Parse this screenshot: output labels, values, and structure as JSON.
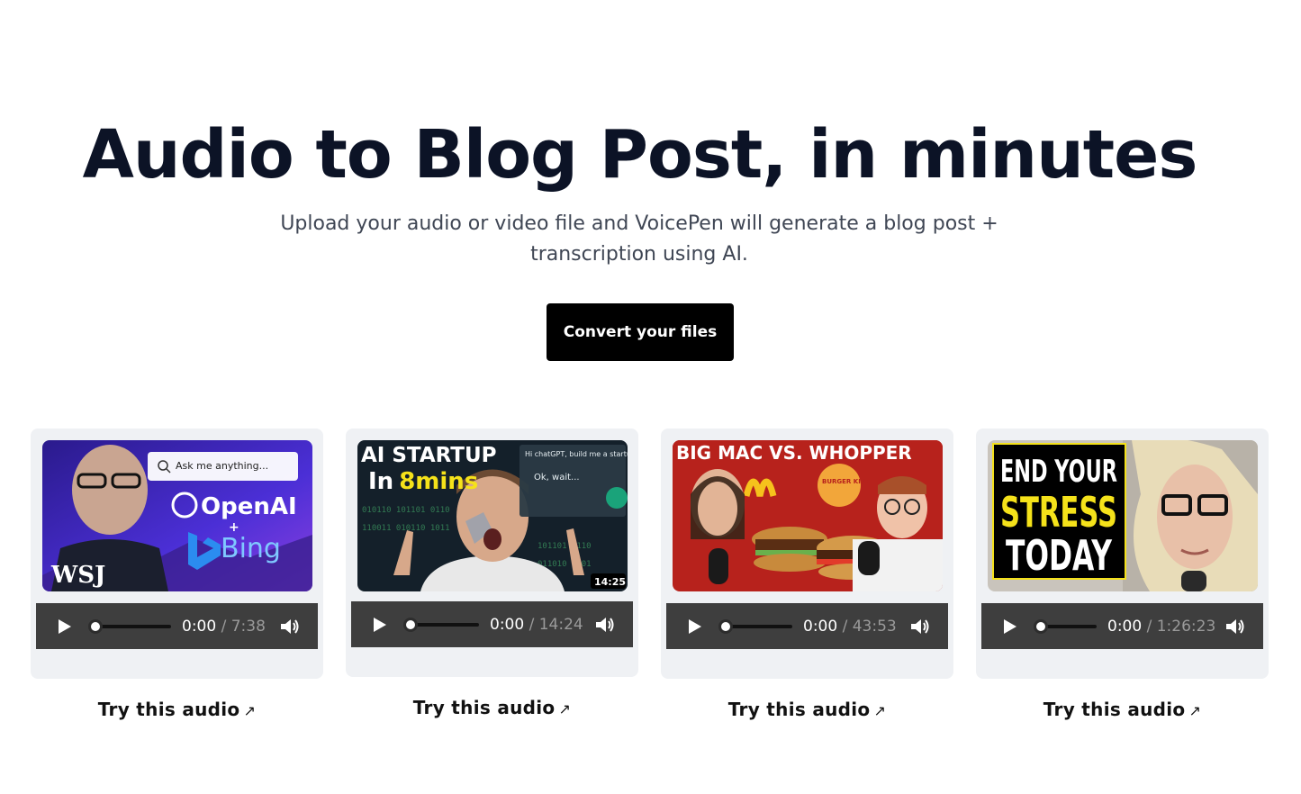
{
  "hero": {
    "title": "Audio to Blog Post, in minutes",
    "subtitle": "Upload your audio or video file and VoicePen will generate a blog post + transcription using AI.",
    "cta_label": "Convert your files"
  },
  "cards": [
    {
      "thumb": {
        "search_text": "Ask me anything...",
        "brand1": "OpenAI",
        "plus": "+",
        "brand2": "Bing",
        "logo": "WSJ"
      },
      "current_time": "0:00",
      "separator": "/",
      "duration": "7:38",
      "try_label": "Try this audio",
      "try_icon": "arrow-up-right-icon"
    },
    {
      "thumb": {
        "headline1": "AI STARTUP",
        "headline2a": "In",
        "headline2b": "8",
        "headline2c": "mins",
        "chat1": "Hi chatGPT, build me a startup",
        "chat2": "Ok, wait...",
        "badge": "14:25"
      },
      "current_time": "0:00",
      "separator": "/",
      "duration": "14:24",
      "try_label": "Try this audio",
      "try_icon": "arrow-up-right-icon"
    },
    {
      "thumb": {
        "headline": "BIG MAC VS. WHOPPER",
        "brand": "BURGER KING"
      },
      "current_time": "0:00",
      "separator": "/",
      "duration": "43:53",
      "try_label": "Try this audio",
      "try_icon": "arrow-up-right-icon"
    },
    {
      "thumb": {
        "line1": "END YOUR",
        "line2": "STRESS",
        "line3": "TODAY"
      },
      "current_time": "0:00",
      "separator": "/",
      "duration": "1:26:23",
      "try_label": "Try this audio",
      "try_icon": "arrow-up-right-icon"
    }
  ],
  "colors": {
    "cta_bg": "#000000",
    "card_bg": "#eff1f4",
    "player_bg": "#3e3e3e",
    "title": "#0c1326",
    "accent_yellow": "#f5e21a"
  }
}
